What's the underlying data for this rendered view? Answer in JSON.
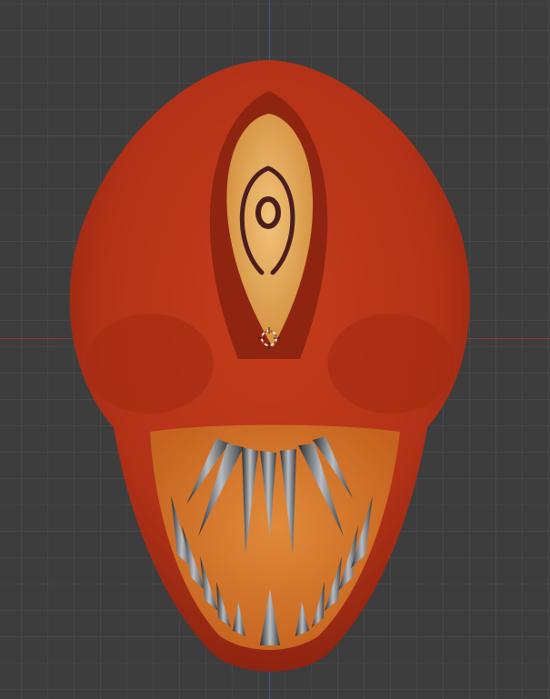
{
  "viewport": {
    "mode": "3D viewport",
    "colors": {
      "background": "#3d3d3d",
      "grid": "#474747",
      "x_axis": "#8a3b40",
      "y_axis": "#3c5c9a",
      "skin": "#b83418",
      "eye": "#e6a957",
      "mouth": "#d77a2c",
      "teeth": "#5a5d60"
    },
    "object": {
      "type": "creature-head-model"
    },
    "cursor": {
      "icon": "3d-cursor-icon"
    }
  }
}
